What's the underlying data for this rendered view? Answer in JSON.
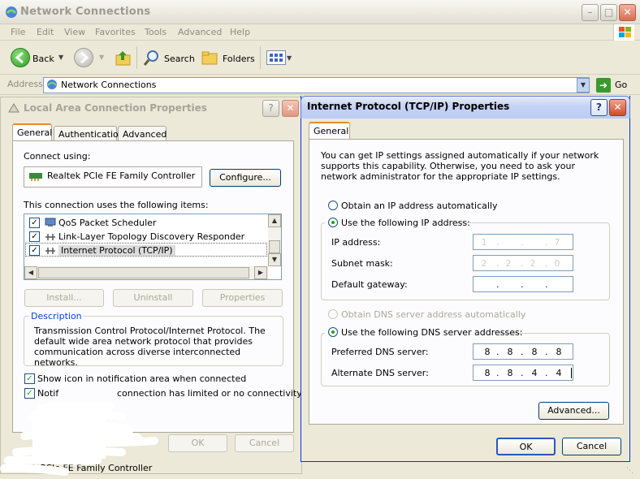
{
  "explorer": {
    "title": "Network Connections",
    "menu": [
      "File",
      "Edit",
      "View",
      "Favorites",
      "Tools",
      "Advanced",
      "Help"
    ],
    "toolbar": {
      "back": "Back",
      "search": "Search",
      "folders": "Folders"
    },
    "address_label": "Address",
    "address_value": "Network Connections",
    "go_label": "Go"
  },
  "lac_dialog": {
    "title": "Local Area Connection Properties",
    "tabs": [
      "General",
      "Authentication",
      "Advanced"
    ],
    "connect_using_label": "Connect using:",
    "adapter_name": "Realtek PCIe FE Family Controller",
    "configure_button": "Configure...",
    "items_label": "This connection uses the following items:",
    "items": [
      {
        "label": "QoS Packet Scheduler",
        "checked": true
      },
      {
        "label": "Link-Layer Topology Discovery Responder",
        "checked": true
      },
      {
        "label": "Internet Protocol (TCP/IP)",
        "checked": true
      }
    ],
    "install_button": "Install...",
    "uninstall_button": "Uninstall",
    "properties_button": "Properties",
    "description_legend": "Description",
    "description_text": "Transmission Control Protocol/Internet Protocol. The default wide area network protocol that provides communication across diverse interconnected networks.",
    "show_icon_label": "Show icon in notification area when connected",
    "notify_label_start": "Notif",
    "notify_label_end": "connection has limited or no connectivity",
    "ok_button": "OK",
    "cancel_button": "Cancel"
  },
  "tcp_dialog": {
    "title": "Internet Protocol (TCP/IP) Properties",
    "tab": "General",
    "info_text": "You can get IP settings assigned automatically if your network supports this capability. Otherwise, you need to ask your network administrator for the appropriate IP settings.",
    "obtain_ip_auto": "Obtain an IP address automatically",
    "use_following_ip": "Use the following IP address:",
    "ip_address_label": "IP address:",
    "ip_address_octets": [
      "1",
      "",
      "",
      "7"
    ],
    "subnet_mask_label": "Subnet mask:",
    "subnet_mask_octets": [
      "2",
      "2",
      "2",
      "0"
    ],
    "gateway_label": "Default gateway:",
    "obtain_dns_auto": "Obtain DNS server address automatically",
    "use_following_dns": "Use the following DNS server addresses:",
    "preferred_dns_label": "Preferred DNS server:",
    "preferred_dns_octets": [
      "8",
      "8",
      "8",
      "8"
    ],
    "alternate_dns_label": "Alternate DNS server:",
    "alternate_dns_octets": [
      "8",
      "8",
      "4",
      "4"
    ],
    "advanced_button": "Advanced...",
    "ok_button": "OK",
    "cancel_button": "Cancel"
  },
  "status_bar": {
    "text": "Realtek PCIe FE Family Controller"
  },
  "colors": {
    "xp_face": "#ece9d8",
    "active_title": "#c6d3f7",
    "radio_dot": "#1ca51c",
    "tab_highlight": "#e68b2c",
    "legend_blue": "#0046d5"
  }
}
